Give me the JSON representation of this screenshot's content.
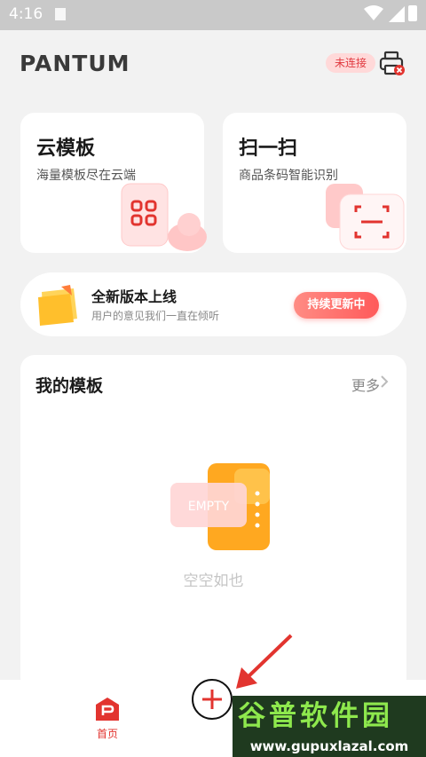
{
  "status_bar": {
    "time": "4:16"
  },
  "header": {
    "logo_text": "PANTUM",
    "connection_badge": "未连接",
    "printer_icon": "printer-x-icon"
  },
  "cards": {
    "cloud": {
      "title": "云模板",
      "subtitle": "海量模板尽在云端",
      "icon": "grid-icon"
    },
    "scan": {
      "title": "扫一扫",
      "subtitle": "商品条码智能识别",
      "icon": "scan-icon"
    }
  },
  "banner": {
    "title": "全新版本上线",
    "subtitle": "用户的意见我们一直在倾听",
    "button": "持续更新中"
  },
  "my_templates": {
    "title": "我的模板",
    "more": "更多",
    "empty_badge": "EMPTY",
    "empty_text": "空空如也"
  },
  "tabbar": {
    "home_label": "首页",
    "add_icon": "plus-icon"
  },
  "watermark": {
    "line1": "谷普软件园",
    "line2": "www.gupuxlazal.com"
  },
  "colors": {
    "accent": "#e2342f",
    "badge_bg": "#ffd9d9",
    "watermark_green": "#8ee84d"
  }
}
